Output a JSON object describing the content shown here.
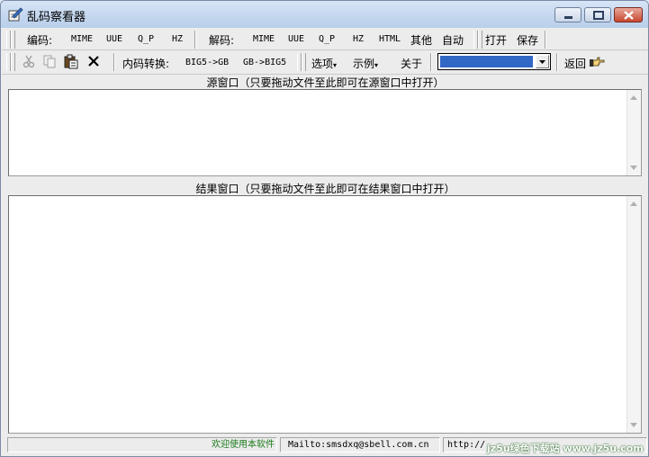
{
  "window": {
    "title": "乱码察看器"
  },
  "toolbar1": {
    "encode_label": "编码:",
    "encode_items": [
      "MIME",
      "UUE",
      "Q_P",
      "HZ"
    ],
    "decode_label": "解码:",
    "decode_items": [
      "MIME",
      "UUE",
      "Q_P",
      "HZ",
      "HTML"
    ],
    "other_label": "其他",
    "auto_label": "自动",
    "open_label": "打开",
    "save_label": "保存"
  },
  "toolbar2": {
    "icons": [
      "cut-icon",
      "copy-icon",
      "paste-icon",
      "delete-icon"
    ],
    "convert_label": "内码转换:",
    "big5_to_gb": "BIG5->GB",
    "gb_to_big5": "GB->BIG5",
    "options_menu": "选项",
    "examples_menu": "示例",
    "about_label": "关于",
    "combo_value": "",
    "back_label": "返回"
  },
  "source_pane": {
    "title": "源窗口（只要拖动文件至此即可在源窗口中打开）"
  },
  "result_pane": {
    "title": "结果窗口（只要拖动文件至此即可在结果窗口中打开）"
  },
  "statusbar": {
    "welcome": "欢迎使用本软件",
    "mailto": "Mailto:smsdxq@sbell.com.cn",
    "url": "http://"
  },
  "watermark": "jz5u绿色下载站 www.jz5u.com",
  "colors": {
    "combo_selection": "#3168c6",
    "close_button": "#c7462d",
    "titlebar": "#c4d7ef"
  }
}
